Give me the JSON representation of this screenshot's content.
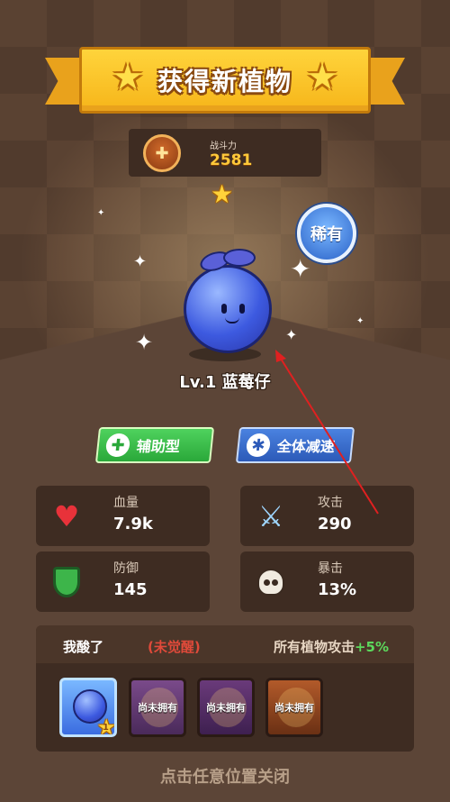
{
  "banner": {
    "title": "获得新植物"
  },
  "power": {
    "label": "战斗力",
    "value": "2581"
  },
  "rarity": {
    "label": "稀有"
  },
  "plant": {
    "name": "Lv.1 蓝莓仔",
    "stars": 1
  },
  "tags": [
    {
      "label": "辅助型",
      "icon": "plus-icon"
    },
    {
      "label": "全体减速",
      "icon": "snowflake-icon"
    }
  ],
  "stats": {
    "hp": {
      "label": "血量",
      "value": "7.9k"
    },
    "attack": {
      "label": "攻击",
      "value": "290"
    },
    "defense": {
      "label": "防御",
      "value": "145"
    },
    "crit": {
      "label": "暴击",
      "value": "13%"
    }
  },
  "skill": {
    "name": "我酸了",
    "status": "(未觉醒)",
    "desc": "所有植物攻击",
    "bonus": "+5%"
  },
  "cards": [
    {
      "label": "",
      "owned": true,
      "stars": "1"
    },
    {
      "label": "尚未拥有",
      "owned": false
    },
    {
      "label": "尚未拥有",
      "owned": false
    },
    {
      "label": "尚未拥有",
      "owned": false
    }
  ],
  "close_hint": "点击任意位置关闭",
  "colors": {
    "accent": "#ffc93a",
    "bonus": "#5cd85c",
    "status": "#e04a3a"
  }
}
